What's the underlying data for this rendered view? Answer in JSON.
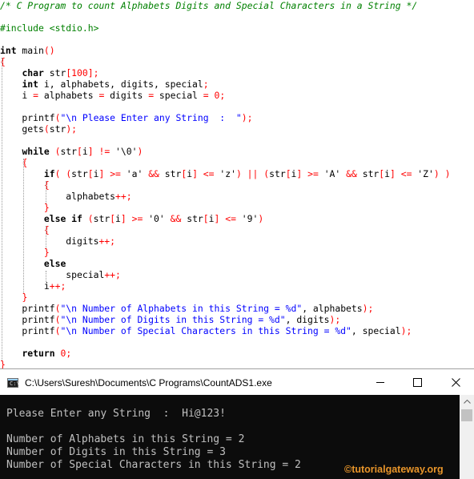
{
  "editor": {
    "lines": [
      [
        [
          "c",
          "/* C Program to count Alphabets Digits and Special Characters in a String */"
        ]
      ],
      [],
      [
        [
          "pre",
          "#include <stdio.h>"
        ]
      ],
      [],
      [
        [
          "kw",
          "int"
        ],
        [
          "p",
          " main"
        ],
        [
          "o",
          "()"
        ]
      ],
      [
        [
          "o",
          "{"
        ]
      ],
      [
        [
          "p",
          "    "
        ],
        [
          "kw",
          "char"
        ],
        [
          "p",
          " str"
        ],
        [
          "o",
          "["
        ],
        [
          "n",
          "100"
        ],
        [
          "o",
          "];"
        ]
      ],
      [
        [
          "p",
          "    "
        ],
        [
          "kw",
          "int"
        ],
        [
          "p",
          " i, alphabets, digits, special"
        ],
        [
          "o",
          ";"
        ]
      ],
      [
        [
          "p",
          "    i "
        ],
        [
          "o",
          "="
        ],
        [
          "p",
          " alphabets "
        ],
        [
          "o",
          "="
        ],
        [
          "p",
          " digits "
        ],
        [
          "o",
          "="
        ],
        [
          "p",
          " special "
        ],
        [
          "o",
          "="
        ],
        [
          "p",
          " "
        ],
        [
          "n",
          "0"
        ],
        [
          "o",
          ";"
        ]
      ],
      [],
      [
        [
          "p",
          "    printf"
        ],
        [
          "o",
          "("
        ],
        [
          "s",
          "\"\\n Please Enter any String  :  \""
        ],
        [
          "o",
          ");"
        ]
      ],
      [
        [
          "p",
          "    gets"
        ],
        [
          "o",
          "("
        ],
        [
          "p",
          "str"
        ],
        [
          "o",
          ");"
        ]
      ],
      [],
      [
        [
          "p",
          "    "
        ],
        [
          "kw",
          "while"
        ],
        [
          "p",
          " "
        ],
        [
          "o",
          "("
        ],
        [
          "p",
          "str"
        ],
        [
          "o",
          "["
        ],
        [
          "p",
          "i"
        ],
        [
          "o",
          "]"
        ],
        [
          "p",
          " "
        ],
        [
          "o",
          "!="
        ],
        [
          "p",
          " '\\0'"
        ],
        [
          "o",
          ")"
        ]
      ],
      [
        [
          "p",
          "    "
        ],
        [
          "o",
          "{"
        ]
      ],
      [
        [
          "p",
          "        "
        ],
        [
          "kw",
          "if"
        ],
        [
          "o",
          "("
        ],
        [
          "p",
          " "
        ],
        [
          "o",
          "("
        ],
        [
          "p",
          "str"
        ],
        [
          "o",
          "["
        ],
        [
          "p",
          "i"
        ],
        [
          "o",
          "]"
        ],
        [
          "p",
          " "
        ],
        [
          "o",
          ">="
        ],
        [
          "p",
          " 'a' "
        ],
        [
          "o",
          "&&"
        ],
        [
          "p",
          " str"
        ],
        [
          "o",
          "["
        ],
        [
          "p",
          "i"
        ],
        [
          "o",
          "]"
        ],
        [
          "p",
          " "
        ],
        [
          "o",
          "<="
        ],
        [
          "p",
          " 'z'"
        ],
        [
          "o",
          ")"
        ],
        [
          "p",
          " "
        ],
        [
          "o",
          "||"
        ],
        [
          "p",
          " "
        ],
        [
          "o",
          "("
        ],
        [
          "p",
          "str"
        ],
        [
          "o",
          "["
        ],
        [
          "p",
          "i"
        ],
        [
          "o",
          "]"
        ],
        [
          "p",
          " "
        ],
        [
          "o",
          ">="
        ],
        [
          "p",
          " 'A' "
        ],
        [
          "o",
          "&&"
        ],
        [
          "p",
          " str"
        ],
        [
          "o",
          "["
        ],
        [
          "p",
          "i"
        ],
        [
          "o",
          "]"
        ],
        [
          "p",
          " "
        ],
        [
          "o",
          "<="
        ],
        [
          "p",
          " 'Z'"
        ],
        [
          "o",
          ")"
        ],
        [
          "p",
          " "
        ],
        [
          "o",
          ")"
        ]
      ],
      [
        [
          "p",
          "        "
        ],
        [
          "o",
          "{"
        ]
      ],
      [
        [
          "p",
          "            alphabets"
        ],
        [
          "o",
          "++;"
        ]
      ],
      [
        [
          "p",
          "        "
        ],
        [
          "o",
          "}"
        ]
      ],
      [
        [
          "p",
          "        "
        ],
        [
          "kw",
          "else if"
        ],
        [
          "p",
          " "
        ],
        [
          "o",
          "("
        ],
        [
          "p",
          "str"
        ],
        [
          "o",
          "["
        ],
        [
          "p",
          "i"
        ],
        [
          "o",
          "]"
        ],
        [
          "p",
          " "
        ],
        [
          "o",
          ">="
        ],
        [
          "p",
          " '0' "
        ],
        [
          "o",
          "&&"
        ],
        [
          "p",
          " str"
        ],
        [
          "o",
          "["
        ],
        [
          "p",
          "i"
        ],
        [
          "o",
          "]"
        ],
        [
          "p",
          " "
        ],
        [
          "o",
          "<="
        ],
        [
          "p",
          " '9'"
        ],
        [
          "o",
          ")"
        ]
      ],
      [
        [
          "p",
          "        "
        ],
        [
          "o",
          "{"
        ]
      ],
      [
        [
          "p",
          "            digits"
        ],
        [
          "o",
          "++;"
        ]
      ],
      [
        [
          "p",
          "        "
        ],
        [
          "o",
          "}"
        ]
      ],
      [
        [
          "p",
          "        "
        ],
        [
          "kw",
          "else"
        ]
      ],
      [
        [
          "p",
          "            special"
        ],
        [
          "o",
          "++;"
        ]
      ],
      [
        [
          "p",
          "        i"
        ],
        [
          "o",
          "++;"
        ]
      ],
      [
        [
          "p",
          "    "
        ],
        [
          "o",
          "}"
        ]
      ],
      [
        [
          "p",
          "    printf"
        ],
        [
          "o",
          "("
        ],
        [
          "s",
          "\"\\n Number of Alphabets in this String = %d\""
        ],
        [
          "p",
          ", alphabets"
        ],
        [
          "o",
          ");"
        ]
      ],
      [
        [
          "p",
          "    printf"
        ],
        [
          "o",
          "("
        ],
        [
          "s",
          "\"\\n Number of Digits in this String = %d\""
        ],
        [
          "p",
          ", digits"
        ],
        [
          "o",
          ");"
        ]
      ],
      [
        [
          "p",
          "    printf"
        ],
        [
          "o",
          "("
        ],
        [
          "s",
          "\"\\n Number of Special Characters in this String = %d\""
        ],
        [
          "p",
          ", special"
        ],
        [
          "o",
          ");"
        ]
      ],
      [],
      [
        [
          "p",
          "    "
        ],
        [
          "kw",
          "return"
        ],
        [
          "p",
          " "
        ],
        [
          "n",
          "0"
        ],
        [
          "o",
          ";"
        ]
      ],
      [
        [
          "o",
          "}"
        ]
      ]
    ]
  },
  "console": {
    "title": "C:\\Users\\Suresh\\Documents\\C Programs\\CountADS1.exe",
    "output": [
      "",
      "Please Enter any String  :  Hi@123!",
      "",
      "Number of Alphabets in this String = 2",
      "Number of Digits in this String = 3",
      "Number of Special Characters in this String = 2"
    ],
    "watermark": "©tutorialgateway.org"
  },
  "colors": {
    "comment": "#008000",
    "keyword": "#000000",
    "operator": "#ff0000",
    "string": "#0000ff",
    "console_bg": "#0c0c0c",
    "console_text": "#c0c0c0",
    "watermark": "#e8952a"
  },
  "icons": {
    "app": "console-app-icon",
    "minimize": "minimize-icon",
    "maximize": "maximize-icon",
    "close": "close-icon",
    "scroll_up": "scroll-up-arrow-icon"
  }
}
